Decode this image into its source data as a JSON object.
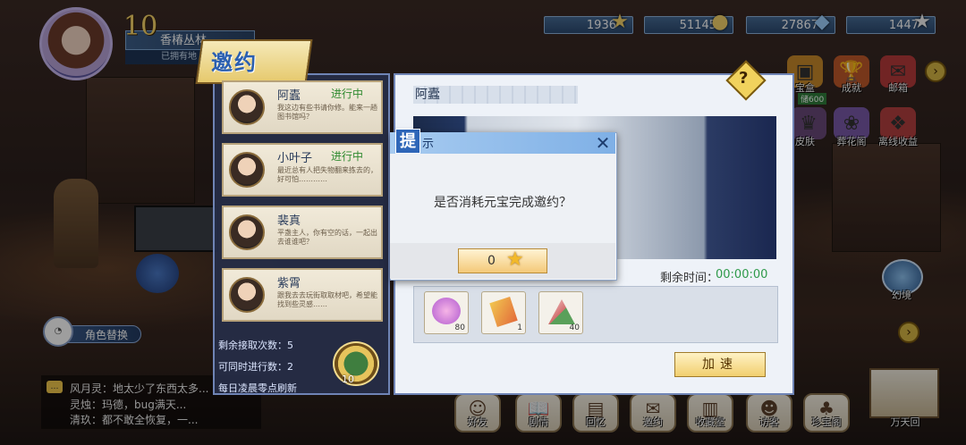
{
  "currencies": [
    {
      "value": "1936",
      "icon": "star-icon"
    },
    {
      "value": "51145",
      "icon": "coin-icon"
    },
    {
      "value": "27867",
      "icon": "diamond-icon"
    },
    {
      "value": "1447",
      "icon": "star-icon"
    }
  ],
  "player": {
    "level": "10",
    "name": "香椿丛林",
    "subtitle": "已拥有地"
  },
  "invite": {
    "title": "邀约",
    "cards": [
      {
        "name": "阿蠹",
        "status": "进行中",
        "desc": "我这边有些书请你修。能来一趟图书馆吗？"
      },
      {
        "name": "小叶子",
        "status": "进行中",
        "desc": "最近总有人把失物翻来拣去的，好可怕…………"
      },
      {
        "name": "裴真",
        "status": "",
        "desc": "平盏主人，你有空的话，一起出去谁谁吧？"
      },
      {
        "name": "紫霄",
        "status": "",
        "desc": "跟我去去玩街取取材吧，希望能找到些灵感……"
      }
    ],
    "remaining_accepts": "剩余接取次数：5",
    "concurrent": "可同时进行数：2",
    "refresh_note": "每日凌晨零点刷新",
    "refresh_count": "10"
  },
  "detail": {
    "name": "阿蠹",
    "time_label": "剩余时间：",
    "time_value": "00:00:00",
    "rewards": [
      {
        "count": "80"
      },
      {
        "count": "1"
      },
      {
        "count": "40"
      }
    ],
    "speedup": "加速"
  },
  "side_menu": [
    {
      "label": "宝盒",
      "sub": "储600"
    },
    {
      "label": "成就"
    },
    {
      "label": "邮箱"
    },
    {
      "label": "皮肤"
    },
    {
      "label": "葬花阁"
    },
    {
      "label": "离线收益"
    },
    {
      "label": "幻境"
    }
  ],
  "bottom_nav": [
    "好友",
    "剧情",
    "回忆",
    "邀约",
    "收藏室",
    "访客",
    "珍宝阁",
    "万天回"
  ],
  "role_switch": "角色替换",
  "chat": [
    "风月灵：地太少了东西太多...",
    "灵烛：玛德，bug满天...",
    "清玖：都不敢全恢复，一..."
  ],
  "dialog": {
    "title_a": "提",
    "title_b": "示",
    "message": "是否消耗元宝完成邀约？",
    "cost": "0"
  }
}
